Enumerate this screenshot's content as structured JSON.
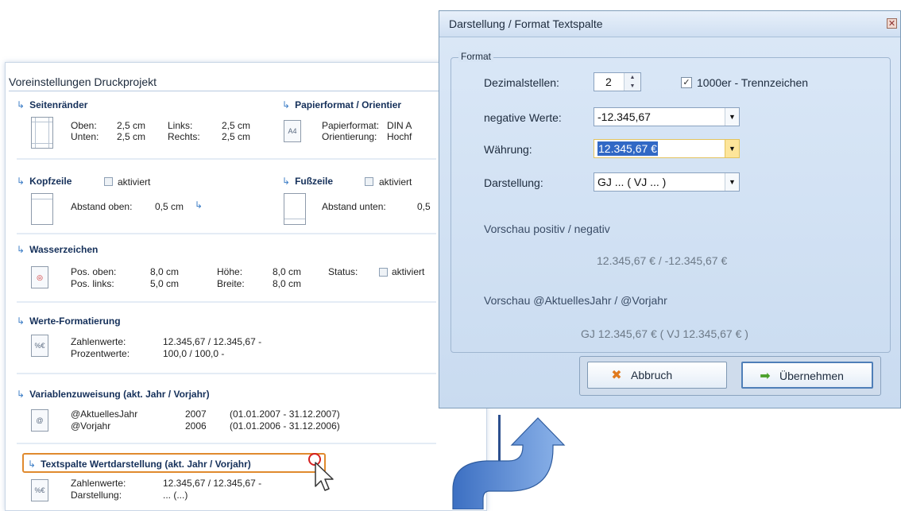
{
  "print_panel": {
    "title": "Voreinstellungen Druckprojekt",
    "margins": {
      "title": "Seitenränder",
      "top_label": "Oben:",
      "top_value": "2,5 cm",
      "bottom_label": "Unten:",
      "bottom_value": "2,5 cm",
      "left_label": "Links:",
      "left_value": "2,5 cm",
      "right_label": "Rechts:",
      "right_value": "2,5 cm"
    },
    "paper": {
      "title": "Papierformat / Orientier",
      "icon_text": "A4",
      "format_label": "Papierformat:",
      "format_value": "DIN A",
      "orientation_label": "Orientierung:",
      "orientation_value": "Hochf"
    },
    "header": {
      "title": "Kopfzeile",
      "checkbox_label": "aktiviert",
      "distance_label": "Abstand oben:",
      "distance_value": "0,5 cm"
    },
    "footer": {
      "title": "Fußzeile",
      "checkbox_label": "aktiviert",
      "distance_label": "Abstand unten:",
      "distance_value": "0,5"
    },
    "watermark": {
      "title": "Wasserzeichen",
      "pos_top_label": "Pos. oben:",
      "pos_top_value": "8,0 cm",
      "pos_left_label": "Pos. links:",
      "pos_left_value": "5,0 cm",
      "height_label": "Höhe:",
      "height_value": "8,0 cm",
      "width_label": "Breite:",
      "width_value": "8,0 cm",
      "status_label": "Status:",
      "status_checkbox_label": "aktiviert"
    },
    "value_format": {
      "title": "Werte-Formatierung",
      "numbers_label": "Zahlenwerte:",
      "numbers_value": "12.345,67  /  12.345,67 -",
      "percent_label": "Prozentwerte:",
      "percent_value": "100,0  /  100,0 -"
    },
    "variables": {
      "title": "Variablenzuweisung  (akt. Jahr / Vorjahr)",
      "rows": [
        {
          "name": "@AktuellesJahr",
          "year": "2007",
          "range": "(01.01.2007 - 31.12.2007)"
        },
        {
          "name": "@Vorjahr",
          "year": "2006",
          "range": "(01.01.2006 - 31.12.2006)"
        }
      ]
    },
    "text_column": {
      "title": "Textspalte Wertdarstellung  (akt. Jahr / Vorjahr)",
      "numbers_label": "Zahlenwerte:",
      "numbers_value": "12.345,67  /  12.345,67 -",
      "display_label": "Darstellung:",
      "display_value": "...  (...)"
    }
  },
  "dialog": {
    "title": "Darstellung / Format Textspalte",
    "close_glyph": "✕",
    "group_label": "Format",
    "decimals_label": "Dezimalstellen:",
    "decimals_value": "2",
    "thousands_label": "1000er - Trennzeichen",
    "thousands_checked": true,
    "negative_label": "negative Werte:",
    "negative_value": "-12.345,67",
    "currency_label": "Währung:",
    "currency_value": "12.345,67 €",
    "display_label": "Darstellung:",
    "display_value": "GJ ...  ( VJ ... )",
    "preview1_label": "Vorschau   positiv / negativ",
    "preview1_value": "12.345,67 €   /   -12.345,67 €",
    "preview2_label": "Vorschau    @AktuellesJahr / @Vorjahr",
    "preview2_value": "GJ 12.345,67 €  ( VJ 12.345,67 € )",
    "cancel_label": "Abbruch",
    "apply_label": "Übernehmen",
    "colors": {
      "accent": "#3168c5",
      "highlight": "#e08a2e",
      "arrow": "#4a7fd0"
    }
  }
}
